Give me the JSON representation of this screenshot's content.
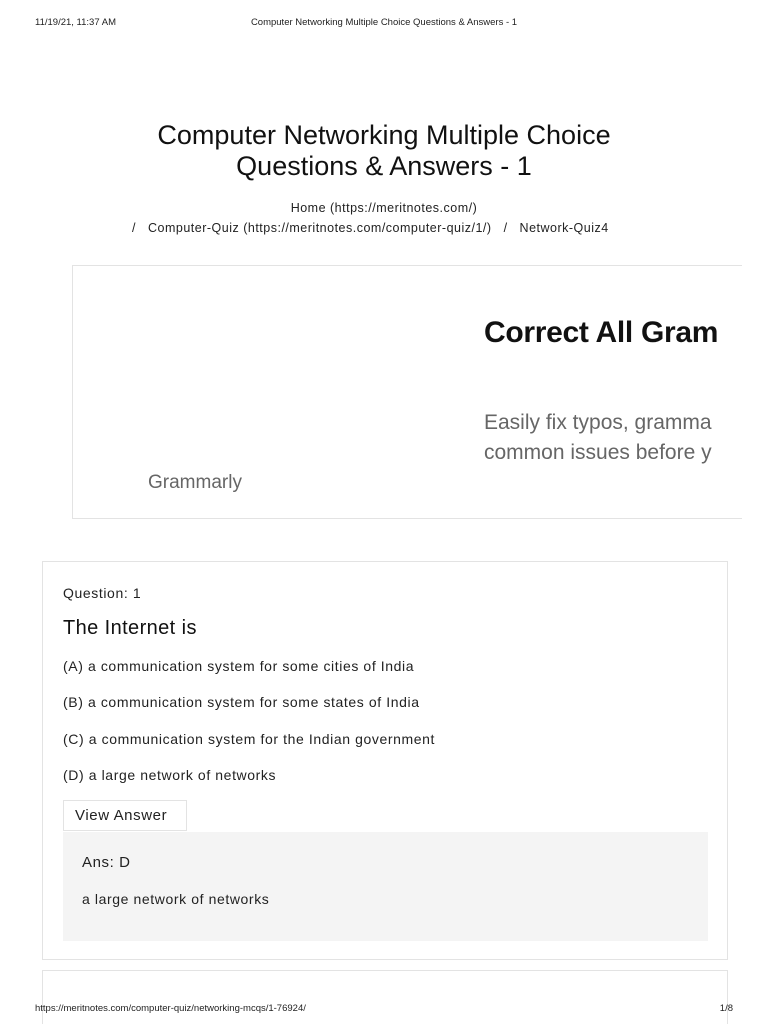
{
  "print_header": {
    "timestamp": "11/19/21, 11:37 AM",
    "title": "Computer Networking Multiple Choice Questions & Answers - 1"
  },
  "page": {
    "title_line1": "Computer Networking Multiple Choice",
    "title_line2": "Questions & Answers - 1"
  },
  "breadcrumb": {
    "home": "Home (https://meritnotes.com/)",
    "separator": "/",
    "computer_quiz": "Computer-Quiz (https://meritnotes.com/computer-quiz/1/)",
    "current": "Network-Quiz4"
  },
  "ad": {
    "headline": "Correct All Gram",
    "body_line1": "Easily fix typos, gramma",
    "body_line2": "common issues before y",
    "brand": "Grammarly"
  },
  "question": {
    "number_label": "Question: 1",
    "text": "The Internet is",
    "options": [
      "(A) a communication system for some cities of India",
      "(B) a communication system for some states of India",
      "(C) a communication system for the Indian government",
      "(D) a large network of networks"
    ],
    "view_answer_label": "View Answer",
    "answer_label": "Ans: D",
    "answer_text": "a large network of networks"
  },
  "print_footer": {
    "url": "https://meritnotes.com/computer-quiz/networking-mcqs/1-76924/",
    "page": "1/8"
  }
}
